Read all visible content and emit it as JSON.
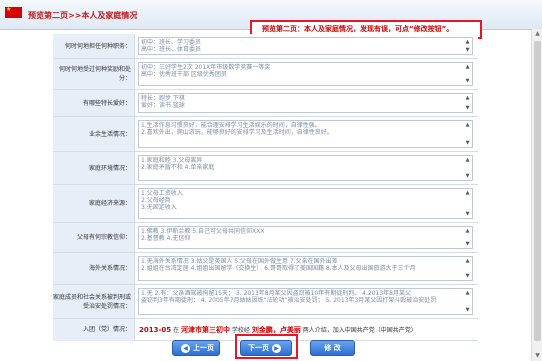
{
  "header": {
    "title": "预览第二页>>本人及家庭情况",
    "note": "预览第二页：本人及家庭情况，发现有误，可点“修改按钮”。"
  },
  "rows": [
    {
      "label": "何时何地担任何种职务：",
      "lines": "初中：班长、学习委员\n高中：班长、体育委员"
    },
    {
      "label": "何时何地受过何种奖励和处分：",
      "lines": "初中：三好学生2次  201X年市级数学竞赛一等奖\n高中：优秀班干部  区级优秀团员"
    },
    {
      "label": "有哪些特长爱好：",
      "lines": "特长：跑步 下棋\n爱好：读书 篮球"
    },
    {
      "label": "业余生活情况：",
      "lines": "1.生活作息习惯良好，能合理安排学习生活娱乐的时间，自律性强。\n2.喜欢外出，爬山游玩，能够良好的安排学习及生活时间，自律性良好。"
    },
    {
      "label": "家庭环境情况：",
      "lines": "1.家庭和睦           3.父母离异\n2.家庭矛盾不和      4.单亲家庭"
    },
    {
      "label": "家庭经济来源：",
      "lines": "1.父母工资收入\n2.父母经商\n3.无固定收入"
    },
    {
      "label": "父母有何宗教信仰：",
      "lines": "1.佛教      3.伊斯兰教    5.自己可父母共同信仰XXX\n2.基督教    4.无信仰"
    },
    {
      "label": "海外关系情况：",
      "lines": "1.无海外关系情况   3.姑父是英国人       5.父母在国外做生意     7.父亲在国外出差\n2.姐姐在台湾定居   4.姐姐出国留学（交换生）  6.哥哥取得了美国国籍    8.本人及父母出国旅游大于三个月"
    },
    {
      "label": "家庭成员和社会关系被判刑或受治安处罚情况：",
      "lines": "1.无  2.有：父亲酒驾被拘留15天；   3. 2013年8月某父因盗窃被10年有期徒刑判。 4.2013年8月某父\n盗窃判3年有期徒刑；  4. 2005年7月姑姑因练“法轮功”被治安处罚；  5. 2013年3月某父因打架斗殴被治安处罚"
    }
  ],
  "intro": {
    "label": "入团（党）情况：",
    "date": "2013-05",
    "place_pre": "在",
    "place": "河津市第三初中",
    "school_suffix": "学校经",
    "sponsors": "刘金鹏，卢美丽",
    "suffix": "两人介绍，加入中国共产党（中国共产党）"
  },
  "buttons": {
    "prev": "上一页",
    "next": "下一页",
    "edit": "修  改"
  }
}
